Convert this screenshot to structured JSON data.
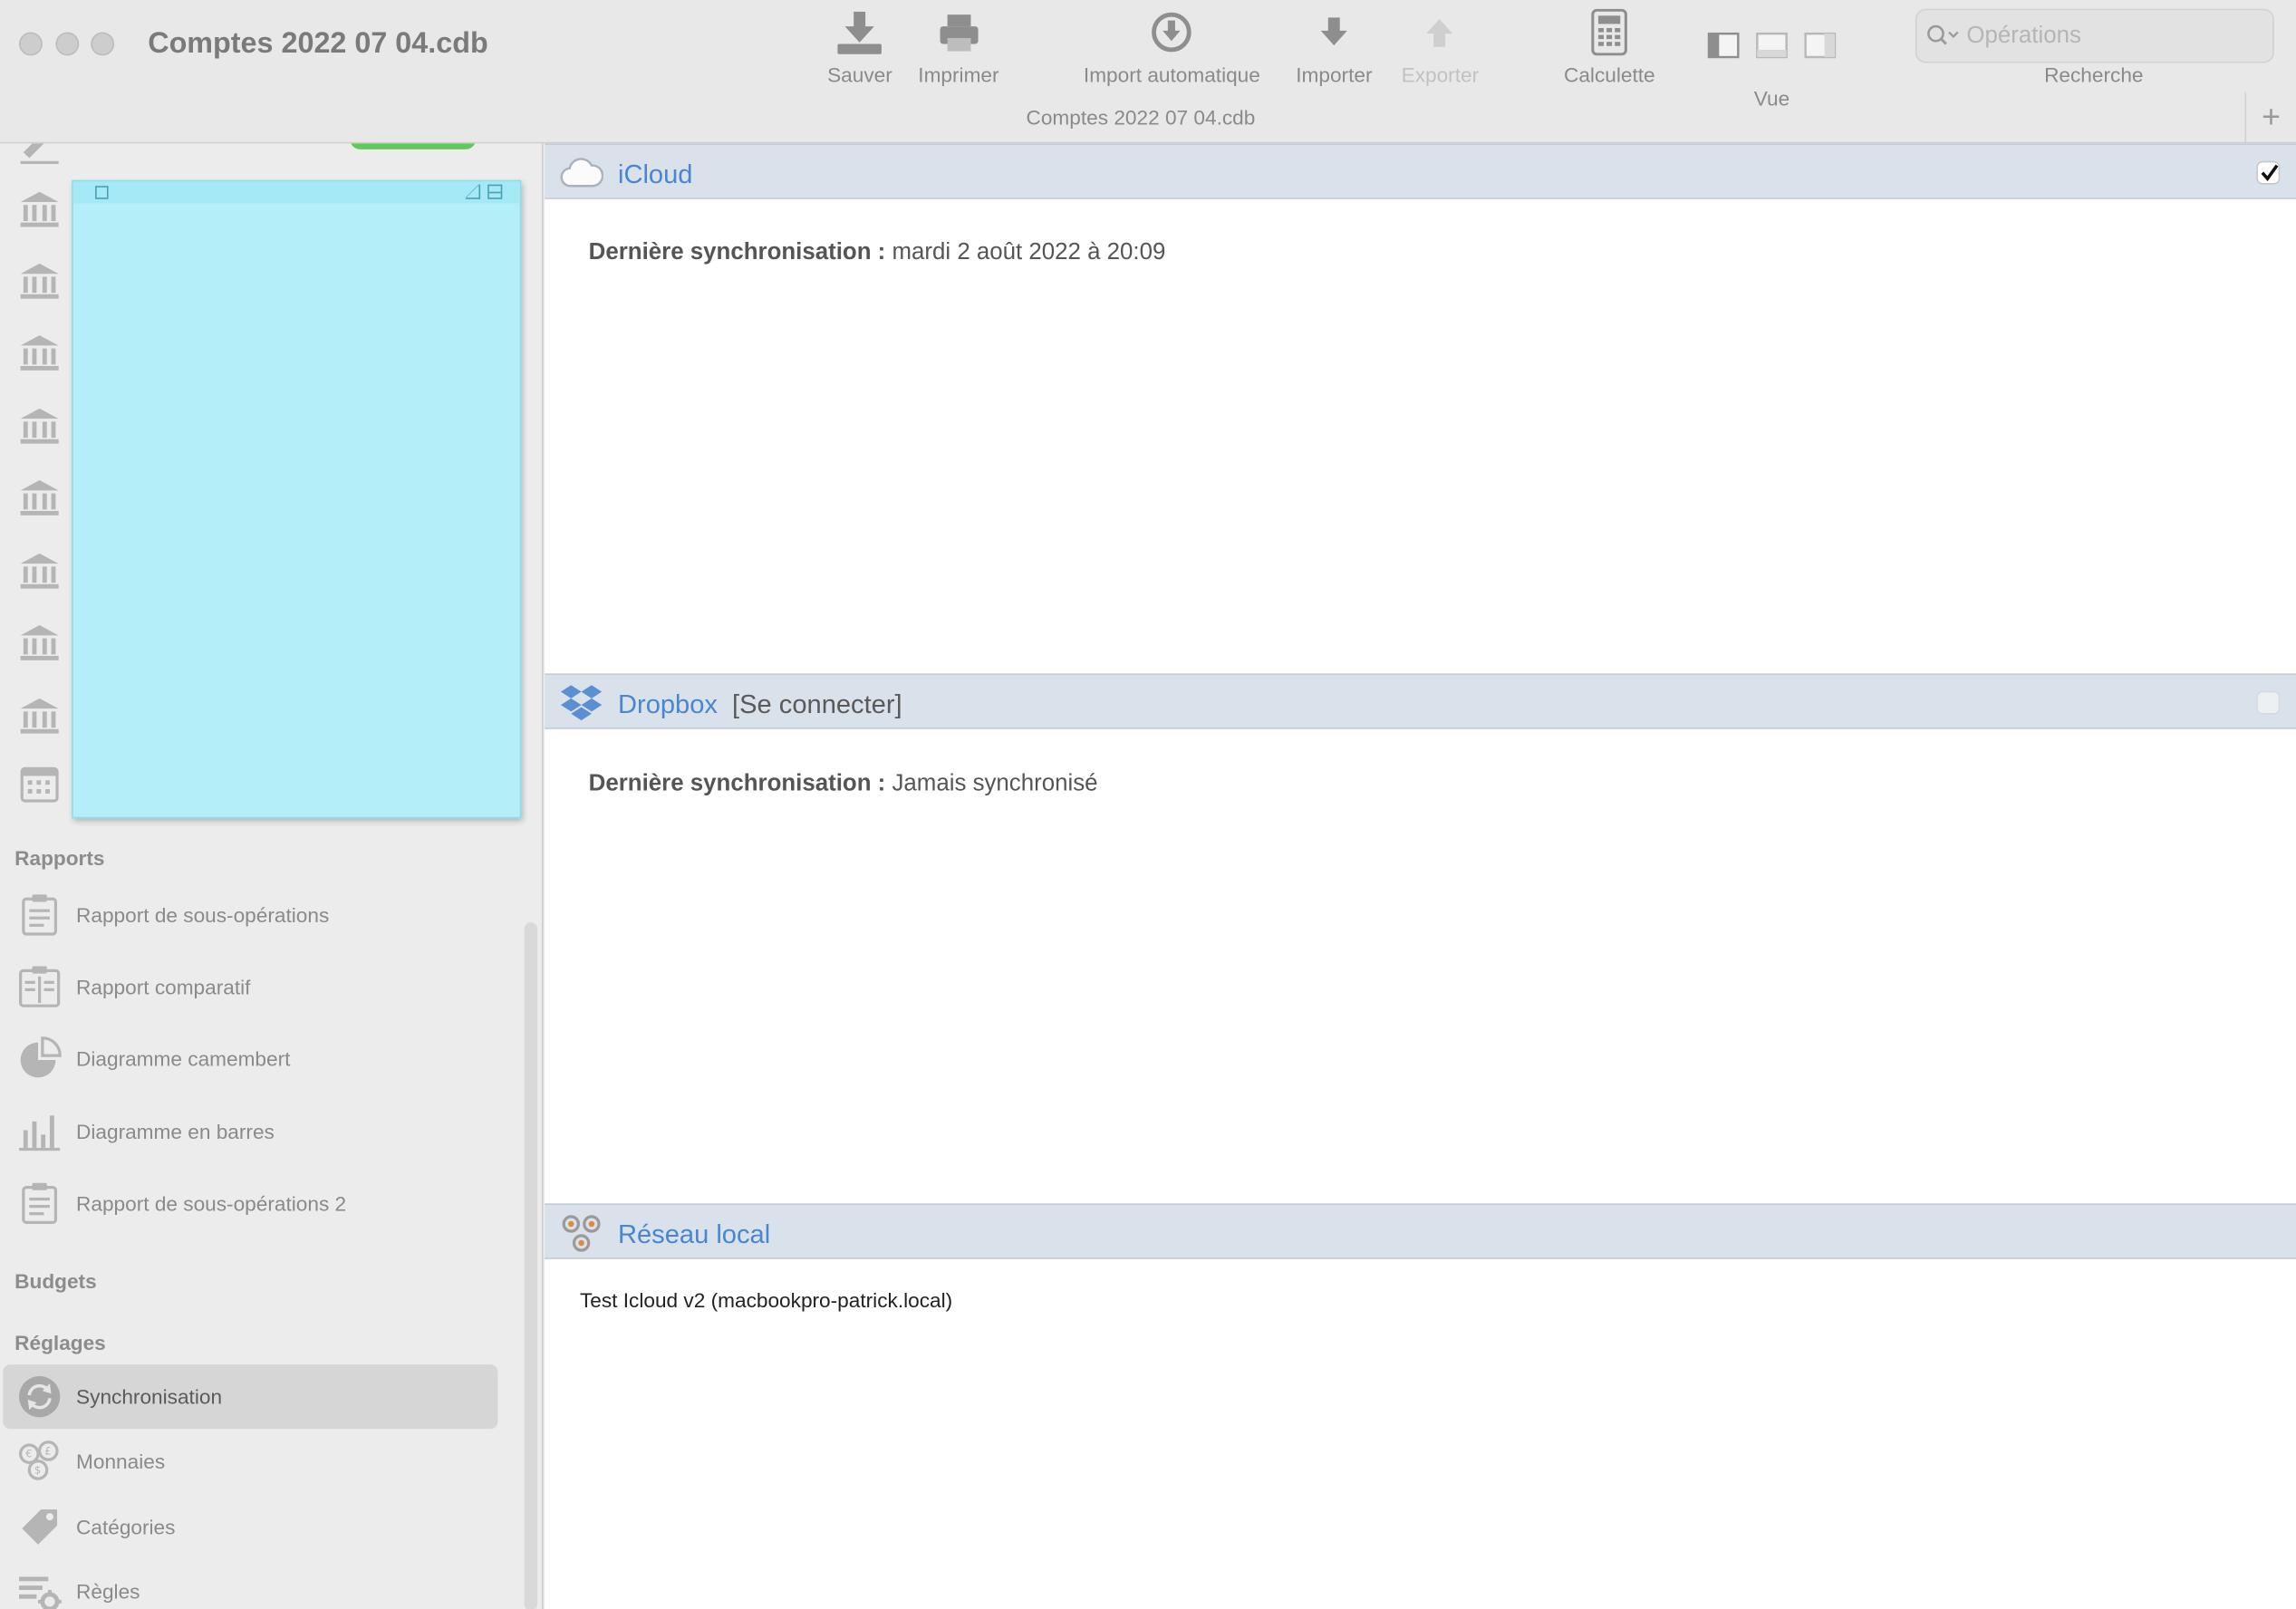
{
  "window": {
    "title": "Comptes 2022 07 04.cdb",
    "subtitle": "Comptes 2022 07 04.cdb"
  },
  "toolbar": {
    "save": "Sauver",
    "print": "Imprimer",
    "auto_import": "Import automatique",
    "import": "Importer",
    "export": "Exporter",
    "calculator": "Calculette",
    "view": "Vue",
    "search_placeholder": "Opérations",
    "search_label": "Recherche"
  },
  "sidebar": {
    "reports_header": "Rapports",
    "reports": [
      {
        "label": "Rapport de sous-opérations",
        "icon": "report-clipboard-icon"
      },
      {
        "label": "Rapport comparatif",
        "icon": "compare-report-icon"
      },
      {
        "label": "Diagramme camembert",
        "icon": "pie-chart-icon"
      },
      {
        "label": "Diagramme en barres",
        "icon": "bar-chart-icon"
      },
      {
        "label": "Rapport de sous-opérations 2",
        "icon": "report-clipboard-icon"
      }
    ],
    "budgets_header": "Budgets",
    "settings_header": "Réglages",
    "settings": [
      {
        "label": "Synchronisation",
        "icon": "sync-icon",
        "selected": true
      },
      {
        "label": "Monnaies",
        "icon": "currencies-icon"
      },
      {
        "label": "Catégories",
        "icon": "tag-icon"
      },
      {
        "label": "Règles",
        "icon": "rules-gear-icon"
      }
    ]
  },
  "sync": {
    "icloud": {
      "name": "iCloud",
      "last_label": "Dernière synchronisation :",
      "last_value": "mardi 2 août 2022 à 20:09",
      "enabled": true
    },
    "dropbox": {
      "name": "Dropbox",
      "connect": "[Se connecter]",
      "last_label": "Dernière synchronisation :",
      "last_value": "Jamais synchronisé",
      "enabled": false
    },
    "local": {
      "name": "Réseau local",
      "device": "Test Icloud v2 (macbookpro-patrick.local)"
    }
  },
  "colors": {
    "accent_link": "#4a86cf",
    "panel_header": "#d9e1ea",
    "note": "#b4eff9"
  }
}
